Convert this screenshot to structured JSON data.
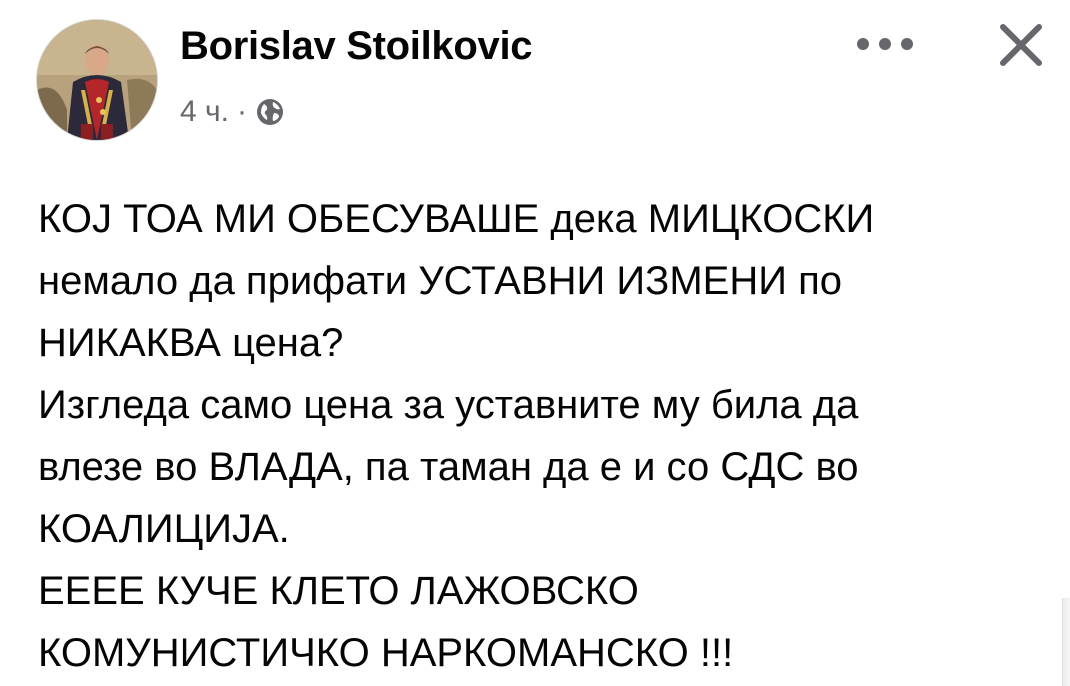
{
  "post": {
    "author_name": "Borislav Stoilkovic",
    "timestamp": "4 ч.",
    "separator": "·",
    "audience_icon": "globe-icon",
    "avatar_icon": "profile-portrait",
    "more_icon": "more-options-icon",
    "close_icon": "close-icon",
    "body_lines": [
      "КОЈ ТОА МИ ОБЕСУВАШЕ дека МИЦКОСКИ",
      "немало да прифати УСТАВНИ ИЗМЕНИ по",
      "НИКАКВА цена?",
      "Изгледа само цена за уставните му била да",
      "влезе во ВЛАДА, па таман да е и со СДС во",
      "КОАЛИЦИЈА.",
      "ЕЕЕЕ КУЧЕ КЛЕТО ЛАЖОВСКО",
      "КОМУНИСТИЧКО НАРКОМАНСКО !!!"
    ]
  },
  "colors": {
    "text_primary": "#050505",
    "text_secondary": "#65676b",
    "icon": "#65676b"
  }
}
